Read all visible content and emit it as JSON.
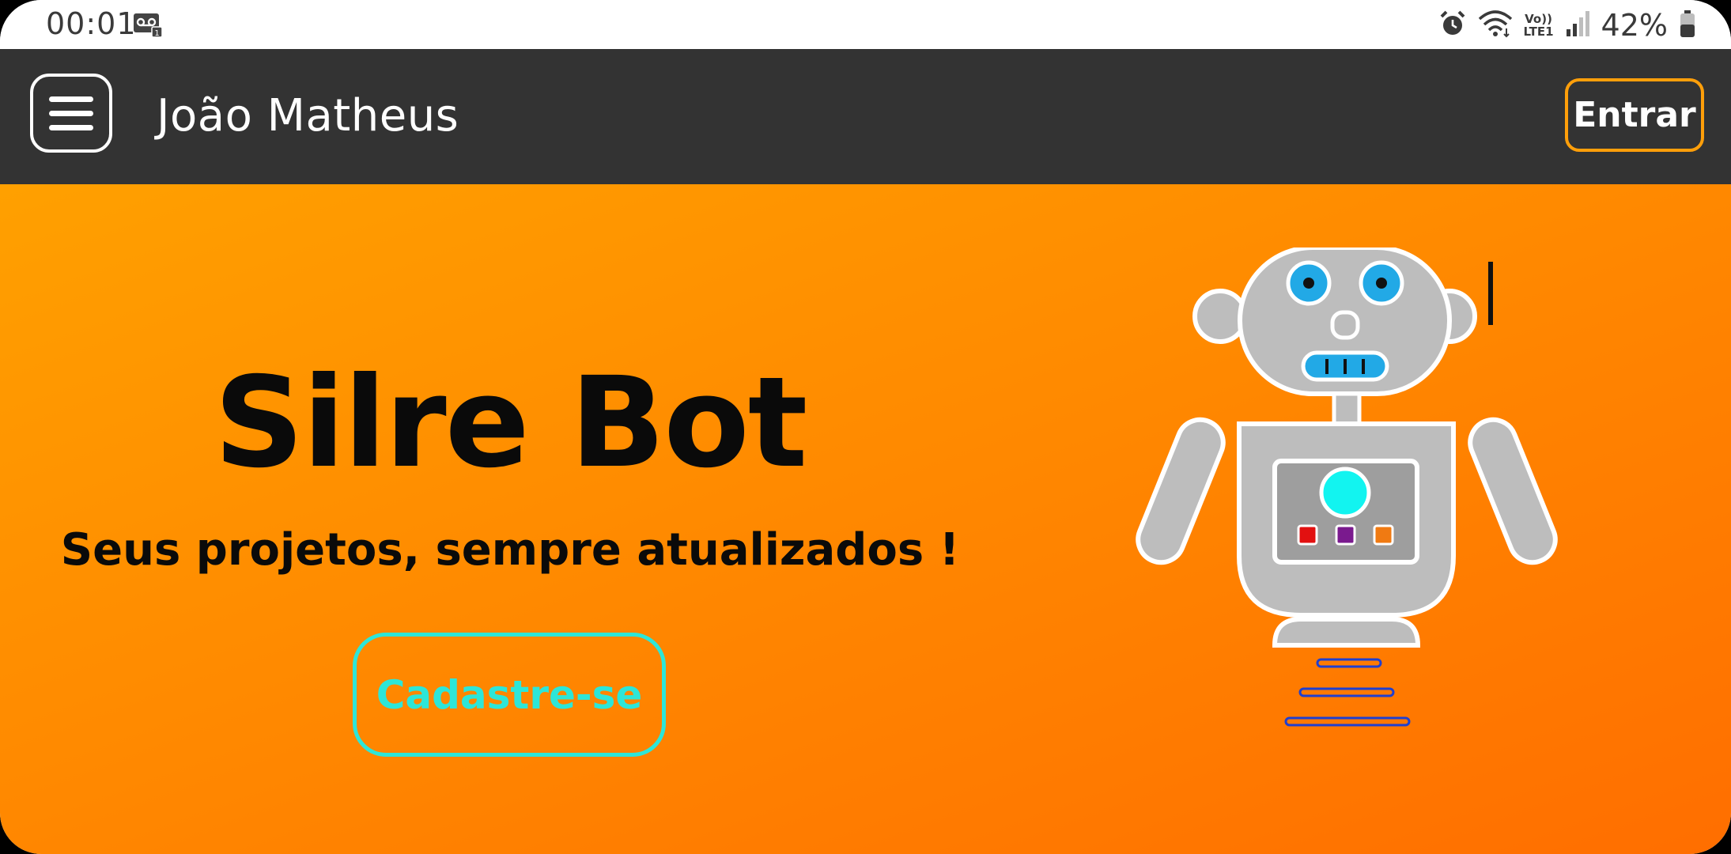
{
  "status_bar": {
    "time": "00:01",
    "battery_percent": "42%",
    "icons": [
      "voicemail-icon",
      "alarm-icon",
      "wifi-icon",
      "volte-lte-icon",
      "signal-icon",
      "battery-icon"
    ],
    "network_label_top": "Vo))",
    "network_label_bottom": "LTE1"
  },
  "app_bar": {
    "menu_icon": "hamburger-menu-icon",
    "title": "João Matheus",
    "login_label": "Entrar"
  },
  "hero": {
    "title": "Silre Bot",
    "subtitle": "Seus projetos, sempre atualizados !",
    "signup_label": "Cadastre-se",
    "illustration": "robot-illustration"
  },
  "colors": {
    "app_bar_bg": "#333333",
    "accent_orange": "#ff9f0a",
    "hero_gradient_start": "#ffa000",
    "hero_gradient_end": "#ff6e00",
    "signup_cyan": "#2de6d8"
  }
}
